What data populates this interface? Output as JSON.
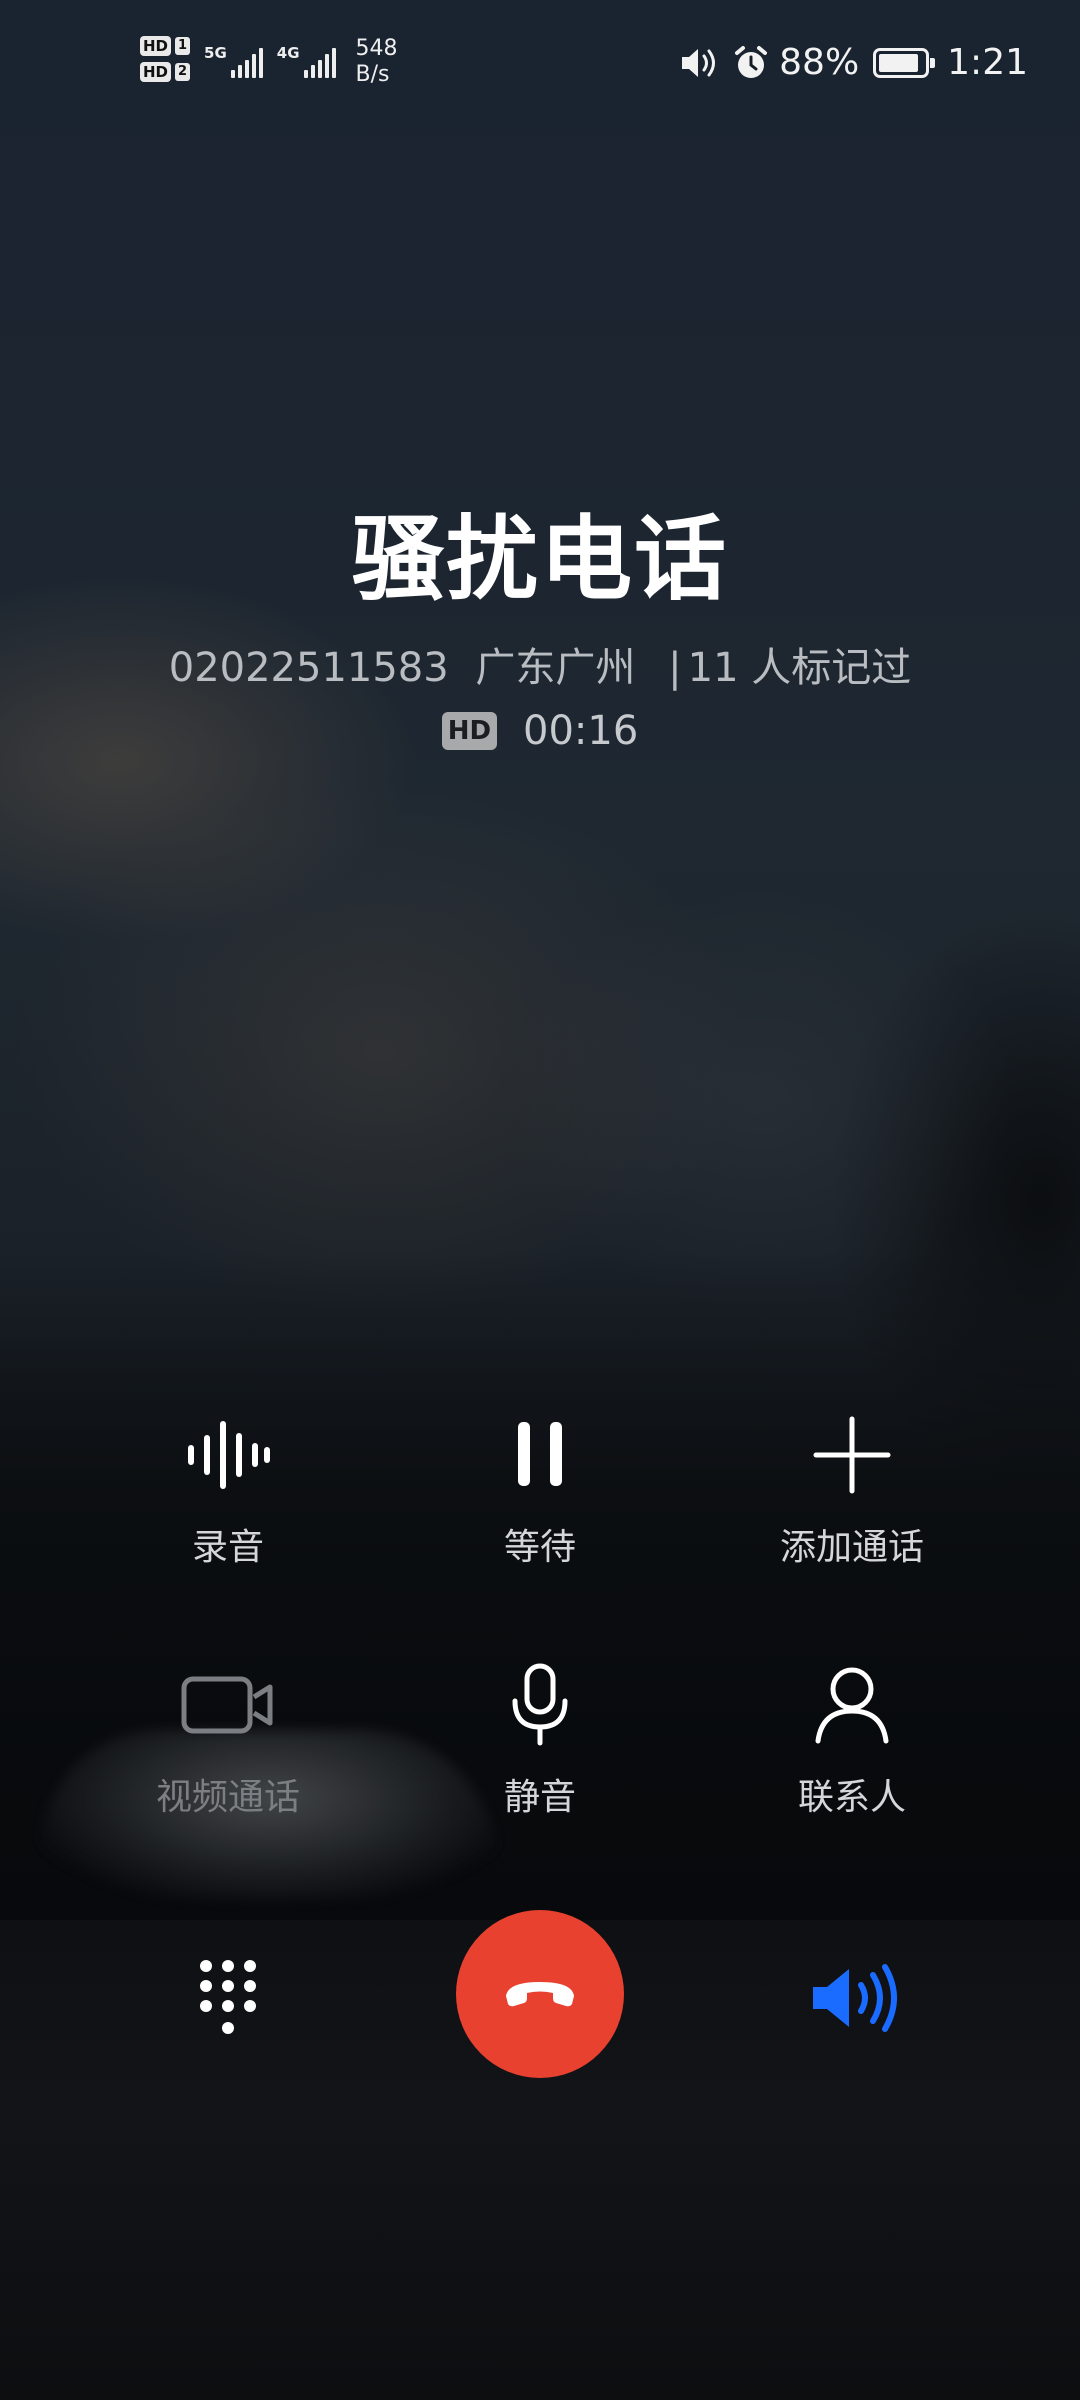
{
  "status_bar": {
    "sim1_badge": "HD",
    "sim1_num": "1",
    "sim2_badge": "HD",
    "sim2_num": "2",
    "net1": "5G",
    "net2": "4G",
    "speed_value": "548",
    "speed_unit": "B/s",
    "battery_percent": "88%",
    "battery_level": 0.88,
    "time": "1:21",
    "icons": [
      "volume-icon",
      "alarm-icon",
      "battery-icon"
    ]
  },
  "caller": {
    "name": "骚扰电话",
    "number": "02022511583",
    "location": "广东广州",
    "separator": "|",
    "marked": "11 人标记过",
    "hd_badge": "HD",
    "duration": "00:16"
  },
  "controls": {
    "record": {
      "label": "录音",
      "icon": "waveform-icon"
    },
    "hold": {
      "label": "等待",
      "icon": "pause-icon"
    },
    "add_call": {
      "label": "添加通话",
      "icon": "plus-icon"
    },
    "video_call": {
      "label": "视频通话",
      "icon": "video-camera-icon",
      "enabled": false
    },
    "mute": {
      "label": "静音",
      "icon": "microphone-icon"
    },
    "contacts": {
      "label": "联系人",
      "icon": "person-icon"
    }
  },
  "bottom_bar": {
    "keypad_icon": "dialpad-icon",
    "hangup_icon": "hang-up-icon",
    "speaker_icon": "speaker-icon",
    "hangup_color": "#e8412f",
    "speaker_color": "#1a6bff"
  }
}
